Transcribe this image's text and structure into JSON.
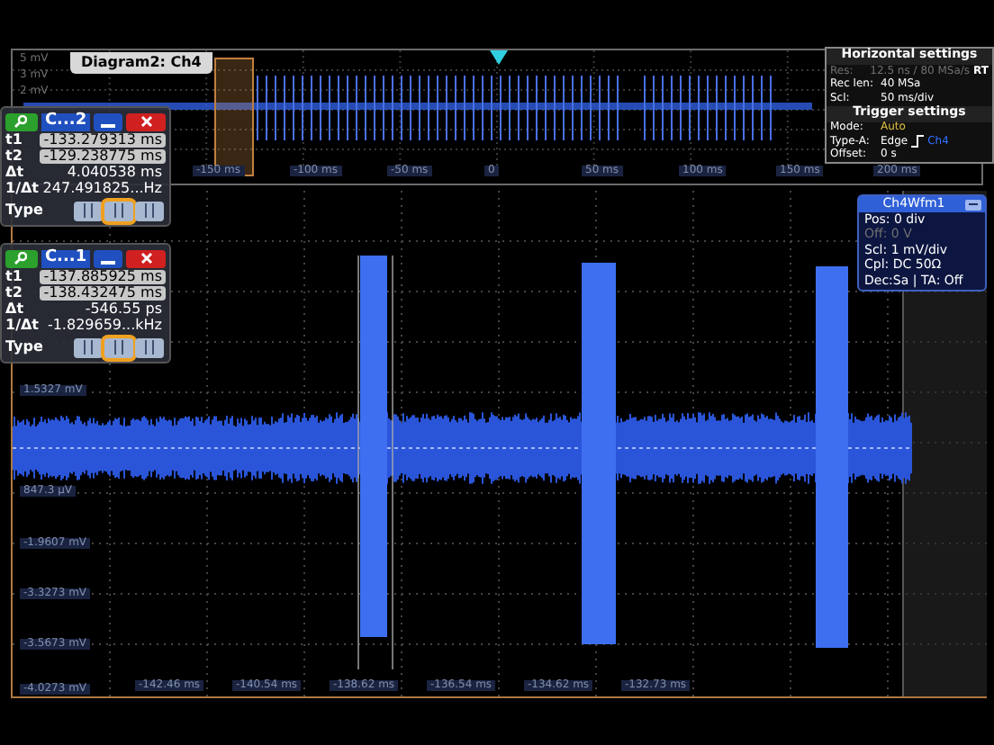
{
  "overview": {
    "tab": "Diagram2: Ch4",
    "y_labels": [
      "5 mV",
      "3 mV",
      "2 mV"
    ],
    "x_labels": [
      "-150 ms",
      "-100 ms",
      "-50 ms",
      "0",
      "50 ms",
      "100 ms",
      "150 ms",
      "200 ms"
    ]
  },
  "cursor_panels": [
    {
      "title": "C...2",
      "rows": [
        {
          "label": "t1",
          "value": "-133.279313 ms",
          "kind": "field"
        },
        {
          "label": "t2",
          "value": "-129.238775 ms",
          "kind": "field"
        },
        {
          "label": "Δt",
          "value": "4.040538 ms",
          "kind": "plain"
        },
        {
          "label": "1/Δt",
          "value": "247.491825...Hz",
          "kind": "plain"
        }
      ],
      "type_label": "Type",
      "type_buttons": [
        {
          "selected": false
        },
        {
          "selected": true
        },
        {
          "selected": false
        }
      ]
    },
    {
      "title": "C...1",
      "rows": [
        {
          "label": "t1",
          "value": "-137.885925 ms",
          "kind": "field"
        },
        {
          "label": "t2",
          "value": "-138.432475 ms",
          "kind": "field"
        },
        {
          "label": "Δt",
          "value": "-546.55 ps",
          "kind": "plain"
        },
        {
          "label": "1/Δt",
          "value": "-1.829659...kHz",
          "kind": "plain"
        }
      ],
      "type_label": "Type",
      "type_buttons": [
        {
          "selected": false
        },
        {
          "selected": true
        },
        {
          "selected": false
        }
      ]
    }
  ],
  "horizontal_settings": {
    "title": "Horizontal settings",
    "badge": "RT",
    "rows": [
      {
        "label": "Res:",
        "value": "12.5 ns / 80 MSa/s",
        "kind": "dimmed"
      },
      {
        "label": "Rec len:",
        "value": "40 MSa",
        "kind": "normal"
      },
      {
        "label": "Scl:",
        "value": "50 ms/div",
        "kind": "normal"
      }
    ]
  },
  "trigger_settings": {
    "title": "Trigger settings",
    "rows": [
      {
        "label": "Mode:",
        "value": "Auto",
        "kind": "highlight"
      },
      {
        "label": "Type-A:",
        "value": "Edge",
        "source": "Ch4",
        "kind": "edge"
      },
      {
        "label": "Offset:",
        "value": "0 s",
        "kind": "normal"
      }
    ]
  },
  "channel_panel": {
    "title": "Ch4Wfm1",
    "rows": [
      {
        "text": "Pos: 0 div",
        "kind": "normal"
      },
      {
        "text": "Off: 0 V",
        "kind": "dimmed"
      },
      {
        "text": "Scl: 1 mV/div",
        "kind": "normal"
      },
      {
        "text": "Cpl: DC 50Ω",
        "kind": "normal"
      },
      {
        "text": "Dec:Sa | TA: Off",
        "kind": "normal"
      }
    ]
  },
  "main": {
    "y_labels": [
      "1.5327 mV",
      "847.3 µV",
      "-1.9607 mV",
      "-3.3273 mV",
      "-3.5673 mV",
      "-4.0273 mV"
    ],
    "x_labels": [
      "-142.46 ms",
      "-140.54 ms",
      "-138.62 ms",
      "-136.54 ms",
      "-134.62 ms",
      "-132.73 ms"
    ]
  }
}
